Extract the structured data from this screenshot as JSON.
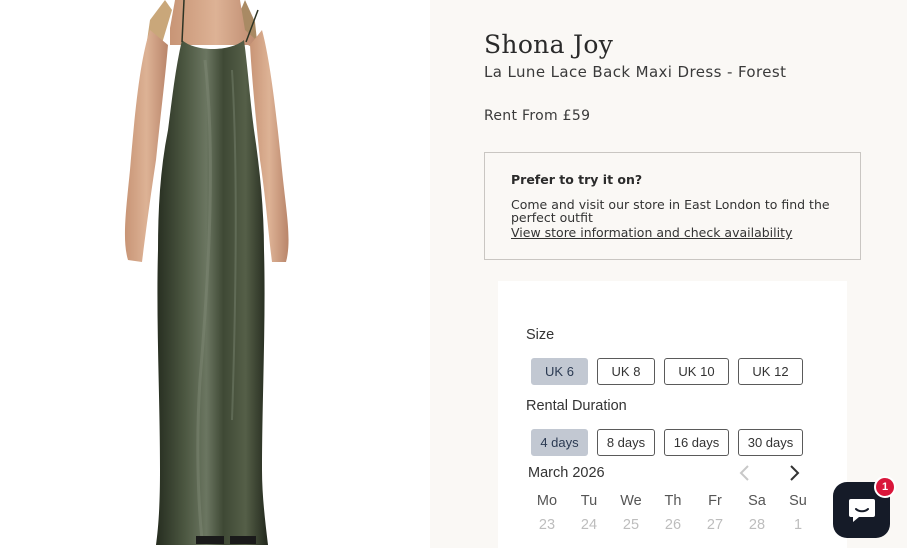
{
  "product": {
    "image_alt": "Green satin maxi dress",
    "brand": "Shona Joy",
    "title": "La Lune Lace Back Maxi Dress - Forest",
    "price": "Rent From £59"
  },
  "try_on": {
    "heading": "Prefer to try it on?",
    "text": "Come and visit our store in East London to find the perfect outfit",
    "link": "View store information and check availability"
  },
  "booking": {
    "size_label": "Size",
    "sizes": [
      "UK 6",
      "UK 8",
      "UK 10",
      "UK 12"
    ],
    "selected_size": "UK 6",
    "duration_label": "Rental Duration",
    "durations": [
      "4 days",
      "8 days",
      "16 days",
      "30 days"
    ],
    "selected_duration": "4 days",
    "calendar": {
      "month": "March 2026",
      "weekdays": [
        "Mo",
        "Tu",
        "We",
        "Th",
        "Fr",
        "Sa",
        "Su"
      ],
      "first_row": [
        "23",
        "24",
        "25",
        "26",
        "27",
        "28",
        "1"
      ]
    }
  },
  "chat": {
    "badge_count": "1",
    "icon": "chat-bubble-icon"
  },
  "colors": {
    "selected_option_bg": "#c2c8d2",
    "chat_button_bg": "#151b28",
    "badge_bg": "#d9163a",
    "dress_green": "#3b4530"
  }
}
